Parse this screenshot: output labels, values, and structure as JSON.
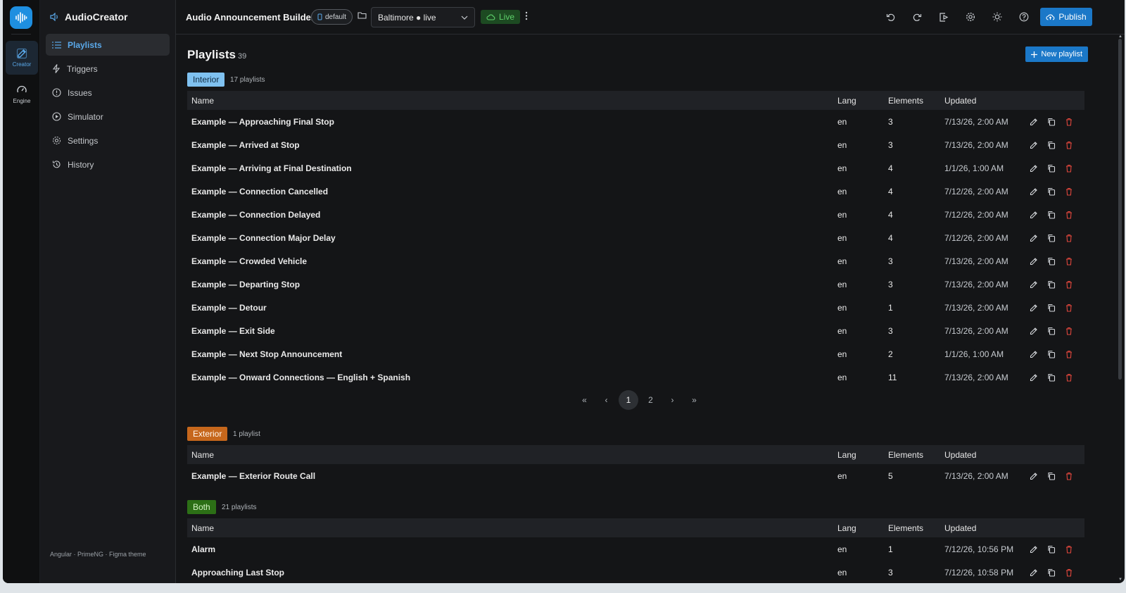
{
  "rail": {
    "items": [
      {
        "label": "Creator",
        "icon": "edit-icon",
        "active": true
      },
      {
        "label": "Engine",
        "icon": "gauge-icon",
        "active": false
      }
    ]
  },
  "sidebar": {
    "brand": "AudioCreator",
    "items": [
      {
        "label": "Playlists",
        "icon": "list-icon",
        "active": true
      },
      {
        "label": "Triggers",
        "icon": "bolt-icon"
      },
      {
        "label": "Issues",
        "icon": "alert-circle-icon"
      },
      {
        "label": "Simulator",
        "icon": "play-circle-icon"
      },
      {
        "label": "Settings",
        "icon": "gear-icon"
      },
      {
        "label": "History",
        "icon": "history-icon"
      }
    ],
    "footer": "Angular · PrimeNG · Figma theme"
  },
  "topbar": {
    "title": "Audio Announcement Builder",
    "branch": "default",
    "environment": "Baltimore ● live",
    "live_label": "Live",
    "publish_label": "Publish"
  },
  "page": {
    "title": "Playlists",
    "count": "39",
    "new_label": "New playlist"
  },
  "columns": {
    "name": "Name",
    "lang": "Lang",
    "elements": "Elements",
    "updated": "Updated"
  },
  "groups": {
    "interior": {
      "tag": "Interior",
      "count": "17 playlists",
      "rows": [
        {
          "name": "Example — Approaching Final Stop",
          "lang": "en",
          "elements": "3",
          "updated": "7/13/26, 2:00 AM"
        },
        {
          "name": "Example — Arrived at Stop",
          "lang": "en",
          "elements": "3",
          "updated": "7/13/26, 2:00 AM"
        },
        {
          "name": "Example — Arriving at Final Destination",
          "lang": "en",
          "elements": "4",
          "updated": "1/1/26, 1:00 AM"
        },
        {
          "name": "Example — Connection Cancelled",
          "lang": "en",
          "elements": "4",
          "updated": "7/12/26, 2:00 AM"
        },
        {
          "name": "Example — Connection Delayed",
          "lang": "en",
          "elements": "4",
          "updated": "7/12/26, 2:00 AM"
        },
        {
          "name": "Example — Connection Major Delay",
          "lang": "en",
          "elements": "4",
          "updated": "7/12/26, 2:00 AM"
        },
        {
          "name": "Example — Crowded Vehicle",
          "lang": "en",
          "elements": "3",
          "updated": "7/13/26, 2:00 AM"
        },
        {
          "name": "Example — Departing Stop",
          "lang": "en",
          "elements": "3",
          "updated": "7/13/26, 2:00 AM"
        },
        {
          "name": "Example — Detour",
          "lang": "en",
          "elements": "1",
          "updated": "7/13/26, 2:00 AM"
        },
        {
          "name": "Example — Exit Side",
          "lang": "en",
          "elements": "3",
          "updated": "7/13/26, 2:00 AM"
        },
        {
          "name": "Example — Next Stop Announcement",
          "lang": "en",
          "elements": "2",
          "updated": "1/1/26, 1:00 AM"
        },
        {
          "name": "Example — Onward Connections — English + Spanish",
          "lang": "en",
          "elements": "11",
          "updated": "7/13/26, 2:00 AM"
        }
      ],
      "pager": {
        "first": "«",
        "prev": "‹",
        "pages": [
          "1",
          "2"
        ],
        "next": "›",
        "last": "»"
      }
    },
    "exterior": {
      "tag": "Exterior",
      "count": "1 playlist",
      "rows": [
        {
          "name": "Example — Exterior Route Call",
          "lang": "en",
          "elements": "5",
          "updated": "7/13/26, 2:00 AM"
        }
      ]
    },
    "both": {
      "tag": "Both",
      "count": "21 playlists",
      "rows": [
        {
          "name": "Alarm",
          "lang": "en",
          "elements": "1",
          "updated": "7/12/26, 10:56 PM"
        },
        {
          "name": "Approaching Last Stop",
          "lang": "en",
          "elements": "3",
          "updated": "7/12/26, 10:58 PM"
        }
      ]
    }
  },
  "colors": {
    "accent": "#1b78c8",
    "live": "#5fd26c",
    "danger": "#e0463c",
    "interior": "#7fc1f0",
    "exterior": "#c6671c",
    "both": "#2c6f16"
  }
}
